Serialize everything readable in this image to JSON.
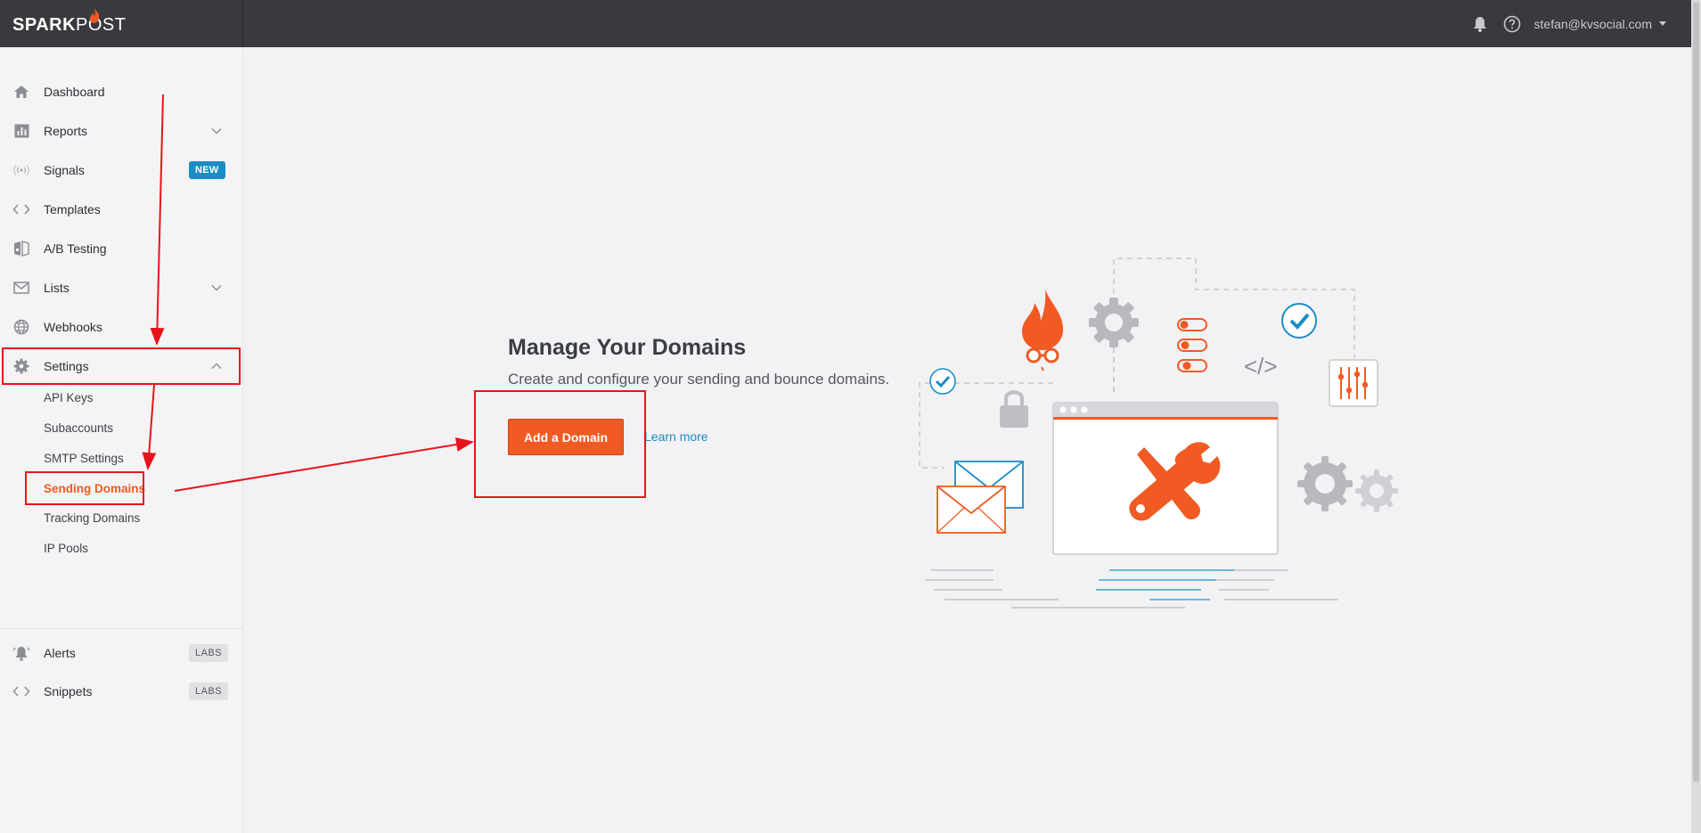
{
  "brand": {
    "logo_bold": "SPARK",
    "logo_light": "POST"
  },
  "header": {
    "user_email": "stefan@kvsocial.com"
  },
  "sidebar": {
    "items": [
      {
        "label": "Dashboard"
      },
      {
        "label": "Reports"
      },
      {
        "label": "Signals",
        "badge": "NEW"
      },
      {
        "label": "Templates"
      },
      {
        "label": "A/B Testing"
      },
      {
        "label": "Lists"
      },
      {
        "label": "Webhooks"
      },
      {
        "label": "Settings"
      }
    ],
    "settings_sub": [
      "API Keys",
      "Subaccounts",
      "SMTP Settings",
      "Sending Domains",
      "Tracking Domains",
      "IP Pools"
    ],
    "labs_items": [
      {
        "label": "Alerts",
        "badge": "LABS"
      },
      {
        "label": "Snippets",
        "badge": "LABS"
      }
    ]
  },
  "main": {
    "title": "Manage Your Domains",
    "subtitle": "Create and configure your sending and bounce domains.",
    "add_button": "Add a Domain",
    "learn_more": "Learn more"
  },
  "illustration": {
    "code_tag": "</>"
  },
  "colors": {
    "accent": "#f15a22",
    "link": "#1a8dc5",
    "annotation": "#e8141b",
    "topbar": "#3a3a3e"
  },
  "icons": [
    "home-icon",
    "bar-chart-icon",
    "signal-icon",
    "code-icon",
    "ab-test-icon",
    "mail-icon",
    "globe-icon",
    "gear-icon",
    "bell-icon",
    "help-icon",
    "caret-down-icon",
    "chevron-down-icon",
    "chevron-up-icon"
  ]
}
